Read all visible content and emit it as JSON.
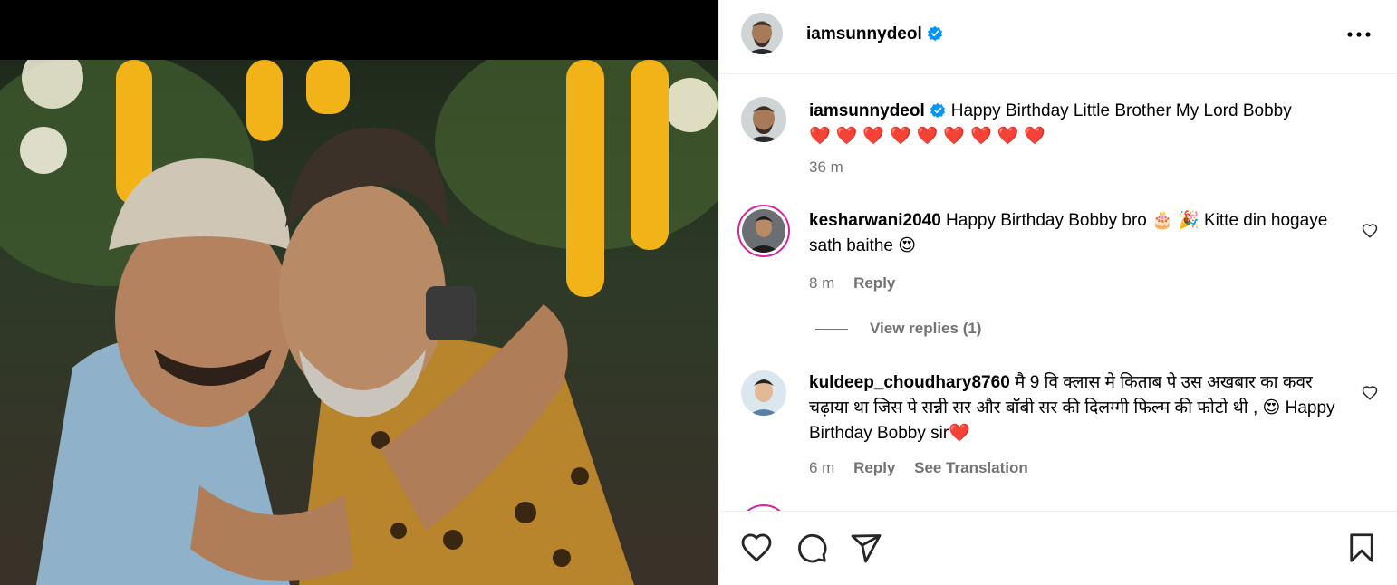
{
  "post": {
    "username": "iamsunnydeol",
    "verified": true,
    "icons": {
      "verified": "verified-badge-icon",
      "more": "more-options-icon",
      "like": "heart-icon",
      "comment": "comment-icon",
      "share": "share-icon",
      "save": "bookmark-icon"
    },
    "colors": {
      "verified": "#0095f6",
      "accent_ring": "#d6249f",
      "secondary_text": "#737373"
    }
  },
  "caption": {
    "username": "iamsunnydeol",
    "text": "Happy Birthday Little Brother My Lord Bobby",
    "emoji": "❤️❤️❤️❤️❤️❤️❤️❤️❤️",
    "time": "36 m"
  },
  "comments": [
    {
      "username": "kesharwani2040",
      "text": "Happy Birthday Bobby bro 🎂 🎉 Kitte din hogaye sath baithe 😍",
      "time": "8 m",
      "reply_label": "Reply",
      "view_replies": "View replies (1)"
    },
    {
      "username": "kuldeep_choudhary8760",
      "text": "मै 9 वि क्लास मे किताब पे उस अखबार का कवर चढ़ाया था जिस पे सन्नी सर और बॉबी सर की दिलग्गी फिल्म की फोटो थी , 😍 Happy Birthday Bobby sir❤️",
      "time": "6 m",
      "reply_label": "Reply",
      "translation_label": "See Translation"
    }
  ]
}
